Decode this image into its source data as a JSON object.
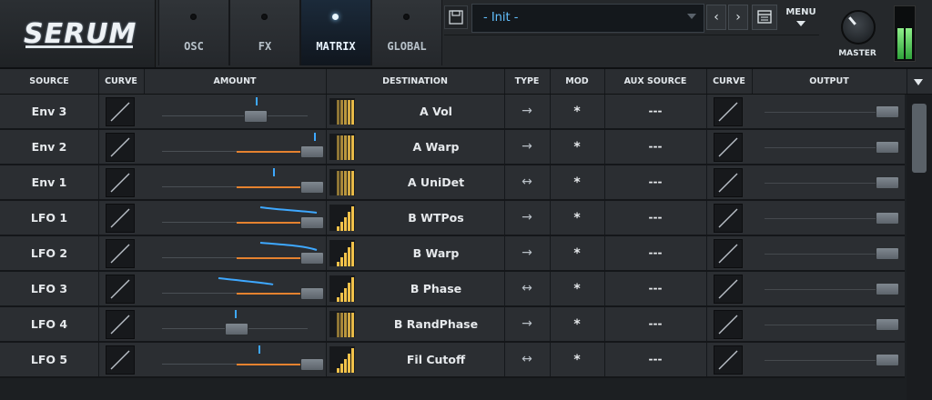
{
  "app": {
    "logo_text": "SERUM"
  },
  "nav_tabs": [
    {
      "label": "OSC",
      "active": false
    },
    {
      "label": "FX",
      "active": false
    },
    {
      "label": "MATRIX",
      "active": true
    },
    {
      "label": "GLOBAL",
      "active": false
    }
  ],
  "preset": {
    "name": "- Init -"
  },
  "toolbar": {
    "prev_label": "‹",
    "next_label": "›",
    "menu_label": "MENU"
  },
  "master": {
    "label": "MASTER"
  },
  "columns": {
    "source": "SOURCE",
    "curve": "CURVE",
    "amount": "AMOUNT",
    "destination": "DESTINATION",
    "type": "TYPE",
    "mod": "MOD",
    "aux_source": "AUX SOURCE",
    "curve2": "CURVE",
    "output": "OUTPUT"
  },
  "rows": [
    {
      "source": "Env 3",
      "destination": "A Vol",
      "type": "→",
      "mod": "*",
      "aux": "---"
    },
    {
      "source": "Env 2",
      "destination": "A Warp",
      "type": "→",
      "mod": "*",
      "aux": "---"
    },
    {
      "source": "Env 1",
      "destination": "A UniDet",
      "type": "↔",
      "mod": "*",
      "aux": "---"
    },
    {
      "source": "LFO 1",
      "destination": "B WTPos",
      "type": "→",
      "mod": "*",
      "aux": "---"
    },
    {
      "source": "LFO 2",
      "destination": "B Warp",
      "type": "→",
      "mod": "*",
      "aux": "---"
    },
    {
      "source": "LFO 3",
      "destination": "B Phase",
      "type": "↔",
      "mod": "*",
      "aux": "---"
    },
    {
      "source": "LFO 4",
      "destination": "B RandPhase",
      "type": "→",
      "mod": "*",
      "aux": "---"
    },
    {
      "source": "LFO 5",
      "destination": "Fil Cutoff",
      "type": "↔",
      "mod": "*",
      "aux": "---"
    }
  ],
  "colors": {
    "accent": "#3ea8ff",
    "amount_fill": "#e5822f",
    "meter": "#4fd35a",
    "thumb": "#f2c24a"
  }
}
